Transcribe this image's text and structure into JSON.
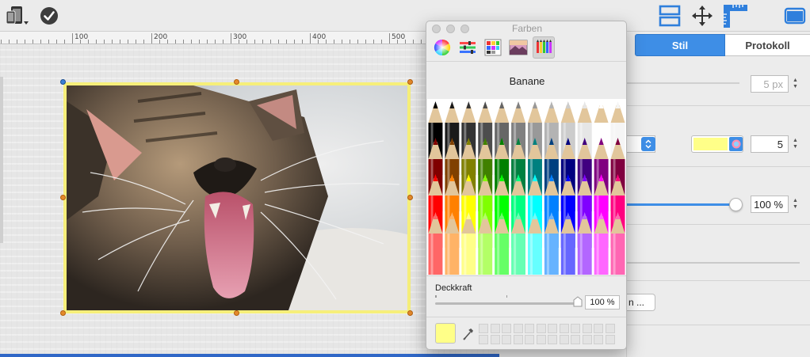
{
  "toolbar": {
    "left_icons": [
      "devices-icon",
      "checkmark-circle-icon"
    ],
    "right_icons": [
      "layout-icon",
      "move-arrows-icon",
      "ruler-icon",
      "window-icon"
    ]
  },
  "ruler": {
    "labels": [
      "100",
      "200",
      "300",
      "400",
      "500"
    ]
  },
  "inspector": {
    "tabs": [
      {
        "label": "Stil",
        "selected": true
      },
      {
        "label": "Protokoll",
        "selected": false
      }
    ],
    "fields": {
      "border_width": "5 px",
      "stroke_number": "5",
      "opacity": "100 %",
      "button_fragment": "n ..."
    },
    "stroke_color": "#ffff88",
    "accent": "#3e8ee6"
  },
  "colors_panel": {
    "title": "Farben",
    "mode_icons": [
      "color-wheel-icon",
      "sliders-icon",
      "palettes-icon",
      "image-palette-icon",
      "pencils-icon"
    ],
    "selected_color_name": "Banane",
    "opacity_label": "Deckkraft",
    "opacity_value": "100 %",
    "opacity_level": 1.0,
    "current_color": "#ffff88",
    "pencil_rows": [
      [
        "#000000",
        "#1a1a1a",
        "#333333",
        "#4d4d4d",
        "#666666",
        "#808080",
        "#999999",
        "#b3b3b3",
        "#cccccc",
        "#e6e6e6",
        "#ffffff",
        "#f5f5f5"
      ],
      [
        "#800000",
        "#804000",
        "#808000",
        "#408000",
        "#008000",
        "#008040",
        "#008080",
        "#004080",
        "#000080",
        "#400080",
        "#800080",
        "#800040"
      ],
      [
        "#ff0000",
        "#ff8000",
        "#ffff00",
        "#80ff00",
        "#00ff00",
        "#00ff80",
        "#00ffff",
        "#0080ff",
        "#0000ff",
        "#8000ff",
        "#ff00ff",
        "#ff0080"
      ],
      [
        "#ff6666",
        "#ffb366",
        "#ffff88",
        "#b3ff66",
        "#66ff66",
        "#66ffb3",
        "#66ffff",
        "#66b3ff",
        "#6666ff",
        "#b366ff",
        "#ff66ff",
        "#ff66b3"
      ]
    ]
  }
}
